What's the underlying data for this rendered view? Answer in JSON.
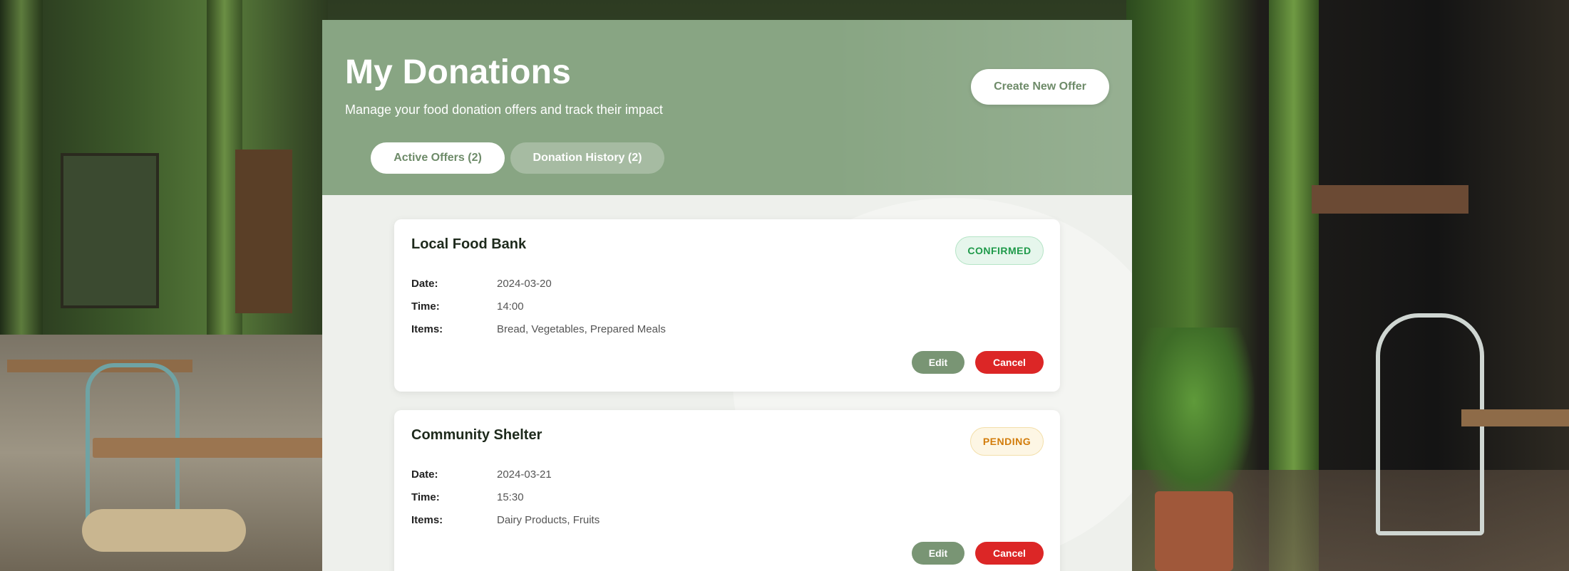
{
  "header": {
    "title": "My Donations",
    "subtitle": "Manage your food donation offers and track their impact",
    "create_button": "Create New Offer"
  },
  "tabs": [
    {
      "label": "Active Offers (2)",
      "active": true
    },
    {
      "label": "Donation History (2)",
      "active": false
    }
  ],
  "labels": {
    "date": "Date:",
    "time": "Time:",
    "items": "Items:",
    "edit": "Edit",
    "cancel": "Cancel"
  },
  "offers": [
    {
      "organization": "Local Food Bank",
      "status": "CONFIRMED",
      "date": "2024-03-20",
      "time": "14:00",
      "items": "Bread, Vegetables, Prepared Meals"
    },
    {
      "organization": "Community Shelter",
      "status": "PENDING",
      "date": "2024-03-21",
      "time": "15:30",
      "items": "Dairy Products, Fruits"
    }
  ],
  "colors": {
    "header_green": "#88a583",
    "accent_green": "#6e8b69",
    "edit_button": "#799574",
    "cancel_button": "#dc2626",
    "confirmed": "#1f9a4a",
    "pending": "#d27c0b"
  }
}
